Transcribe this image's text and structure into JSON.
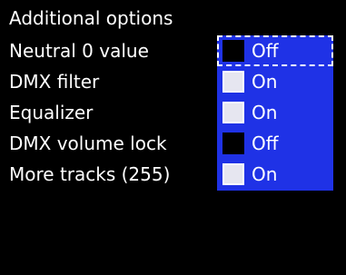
{
  "title": "Additional options",
  "options": [
    {
      "label": "Neutral 0 value",
      "state": "Off",
      "checked": false,
      "selected": true
    },
    {
      "label": "DMX filter",
      "state": "On",
      "checked": true,
      "selected": false
    },
    {
      "label": "Equalizer",
      "state": "On",
      "checked": true,
      "selected": false
    },
    {
      "label": "DMX volume lock",
      "state": "Off",
      "checked": false,
      "selected": false
    },
    {
      "label": "More tracks (255)",
      "state": "On",
      "checked": true,
      "selected": false
    }
  ],
  "colors": {
    "background": "#000000",
    "text": "#ffffff",
    "panel": "#1f32e6",
    "checkbox_on": "#e6e6f0",
    "checkbox_off": "#000000"
  }
}
